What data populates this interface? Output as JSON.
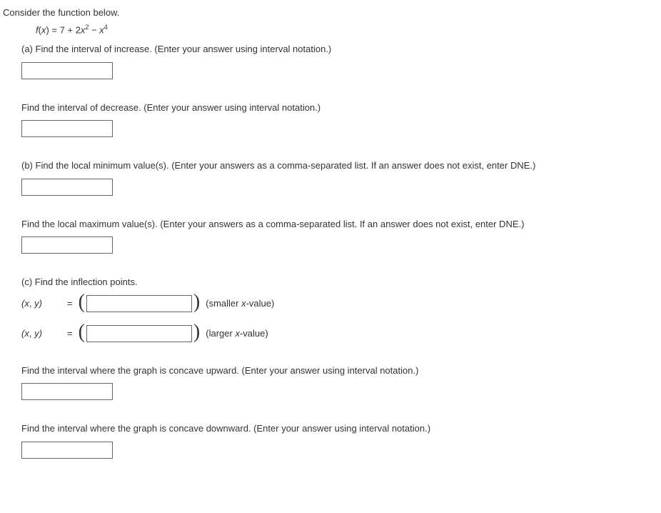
{
  "intro": "Consider the function below.",
  "formula_parts": {
    "fx": "f",
    "paren": "(",
    "x": "x",
    "paren2": ") = ",
    "term1": "7",
    "plus": " + ",
    "coef2": "2",
    "x2": "x",
    "sup2": "2",
    "minus": " − ",
    "x4": "x",
    "sup4": "4"
  },
  "parts": {
    "a1": "(a) Find the interval of increase. (Enter your answer using interval notation.)",
    "a2": "Find the interval of decrease. (Enter your answer using interval notation.)",
    "b1": "(b) Find the local minimum value(s). (Enter your answers as a comma-separated list. If an answer does not exist, enter DNE.)",
    "b2": "Find the local maximum value(s). (Enter your answers as a comma-separated list. If an answer does not exist, enter DNE.)",
    "c_intro": "(c) Find the inflection points.",
    "xy1": "(x, y)",
    "eq": "=",
    "smaller": "(smaller ",
    "smaller_x": "x",
    "smaller_end": "-value)",
    "larger": "(larger ",
    "larger_x": "x",
    "larger_end": "-value)",
    "c_up": "Find the interval where the graph is concave upward. (Enter your answer using interval notation.)",
    "c_down": "Find the interval where the graph is concave downward. (Enter your answer using interval notation.)"
  }
}
